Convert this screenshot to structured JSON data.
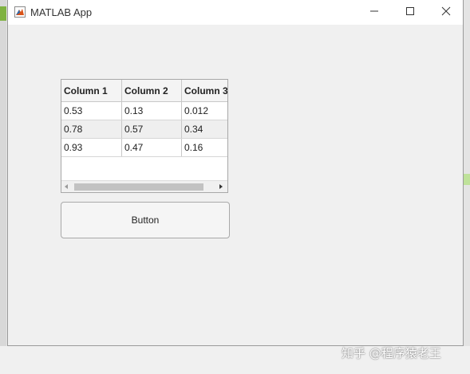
{
  "window": {
    "title": "MATLAB App",
    "controls": {
      "minimize_icon": "minimize-icon",
      "maximize_icon": "maximize-icon",
      "close_icon": "close-icon"
    }
  },
  "table": {
    "columns": [
      "Column 1",
      "Column 2",
      "Column 3"
    ],
    "rows": [
      [
        "0.53",
        "0.13",
        "0.012"
      ],
      [
        "0.78",
        "0.57",
        "0.34"
      ],
      [
        "0.93",
        "0.47",
        "0.16"
      ]
    ]
  },
  "button": {
    "label": "Button"
  },
  "watermark": "知乎 @程序猿老王",
  "colors": {
    "window_bg": "#f0f0f0",
    "titlebar_bg": "#ffffff",
    "table_alt_row": "#efefef",
    "matlab_icon": "#d95319"
  }
}
